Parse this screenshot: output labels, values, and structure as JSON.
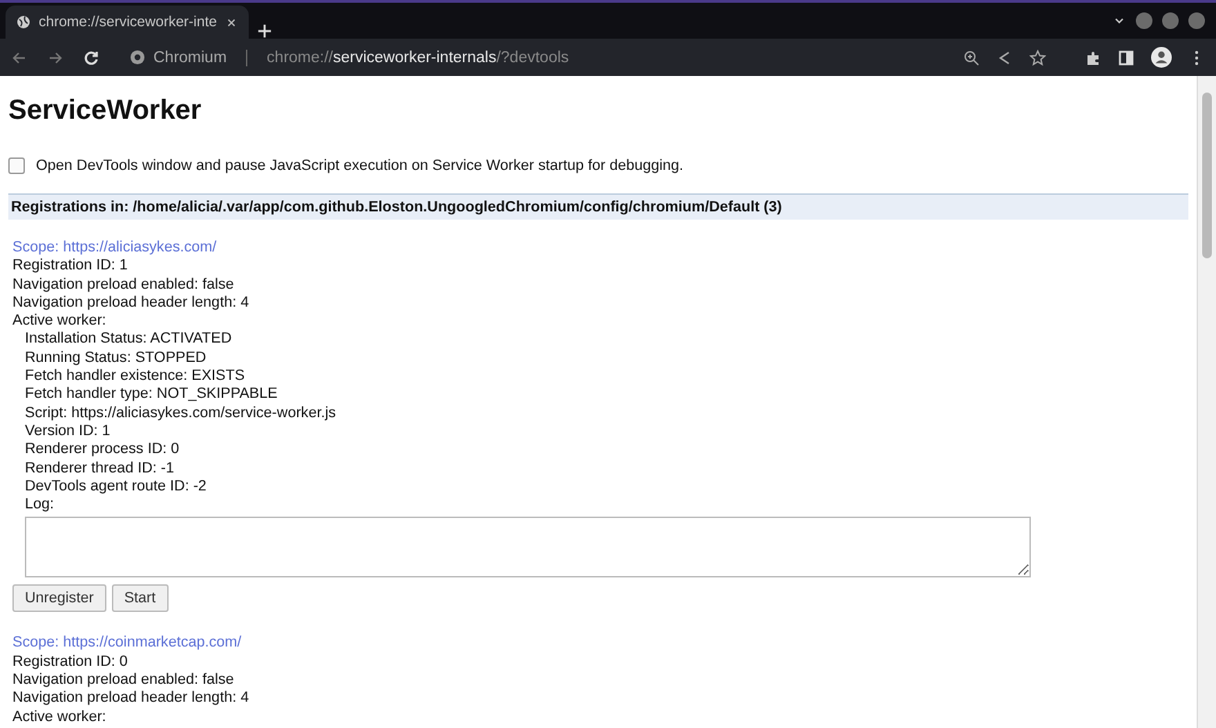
{
  "browser": {
    "tabs": [
      {
        "title": "chrome://serviceworker-inte",
        "selected": true
      }
    ],
    "address": {
      "site_label": "Chromium",
      "url": "chrome://**serviceworker-internals**/?devtools"
    }
  },
  "page": {
    "title": "ServiceWorker",
    "debug_option": {
      "label": "Open DevTools window and pause JavaScript execution on Service Worker startup for debugging.",
      "checked": false
    },
    "registrations_header": "Registrations in: /home/alicia/.var/app/com.github.Eloston.UngoogledChromium/config/chromium/Default (3)",
    "registrations": [
      {
        "scope": "Scope: https://aliciasykes.com/",
        "fields": [
          "Registration ID: 1",
          "Navigation preload enabled: false",
          "Navigation preload header length: 4"
        ],
        "active_worker": {
          "label": "Active worker:",
          "fields": [
            "Installation Status: ACTIVATED",
            "Running Status: STOPPED",
            "Fetch handler existence: EXISTS",
            "Fetch handler type: NOT_SKIPPABLE",
            "Script: https://aliciasykes.com/service-worker.js",
            "Version ID: 1",
            "Renderer process ID: 0",
            "Renderer thread ID: -1",
            "DevTools agent route ID: -2"
          ],
          "log_label": "Log:"
        },
        "buttons": [
          "Unregister",
          "Start"
        ]
      },
      {
        "scope": "Scope: https://coinmarketcap.com/",
        "fields": [
          "Registration ID: 0",
          "Navigation preload enabled: false",
          "Navigation preload header length: 4"
        ],
        "active_worker": {
          "label": "Active worker:"
        }
      }
    ]
  }
}
